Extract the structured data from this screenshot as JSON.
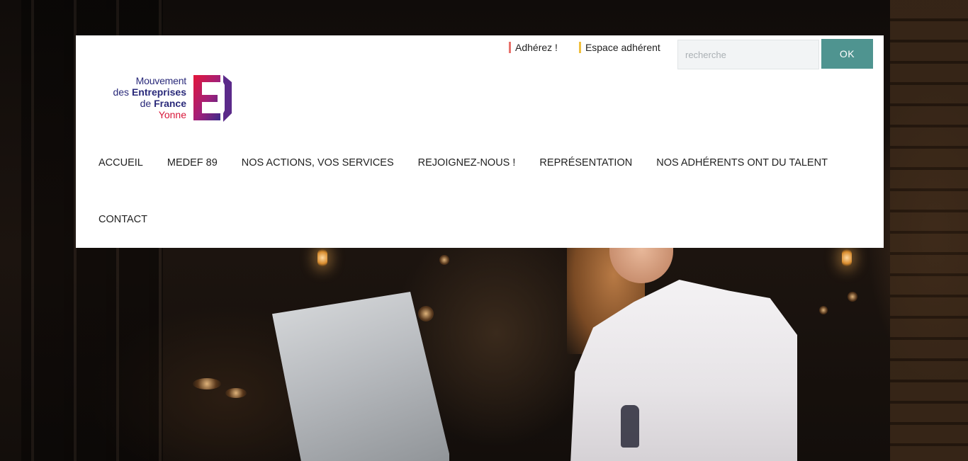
{
  "brand": {
    "logo_line1": "Mouvement",
    "logo_line2_prefix": "des ",
    "logo_line2_bold": "Entreprises",
    "logo_line3_prefix": "de ",
    "logo_line3_bold": "France",
    "logo_line4": "Yonne",
    "colors": {
      "navy": "#2a2a7a",
      "red": "#d8173a",
      "purple": "#6a1f8a"
    }
  },
  "top_links": [
    {
      "label": "Adhérez !",
      "accent": "#e8726d"
    },
    {
      "label": "Espace adhérent",
      "accent": "#f0c040"
    }
  ],
  "search": {
    "placeholder": "recherche",
    "value": "",
    "button_label": "OK",
    "button_color": "#4f9490"
  },
  "nav": {
    "items": [
      "ACCUEIL",
      "MEDEF 89",
      "NOS ACTIONS, VOS SERVICES",
      "REJOIGNEZ-NOUS !",
      "REPRÉSENTATION",
      "NOS ADHÉRENTS ONT DU TALENT",
      "CONTACT"
    ]
  }
}
